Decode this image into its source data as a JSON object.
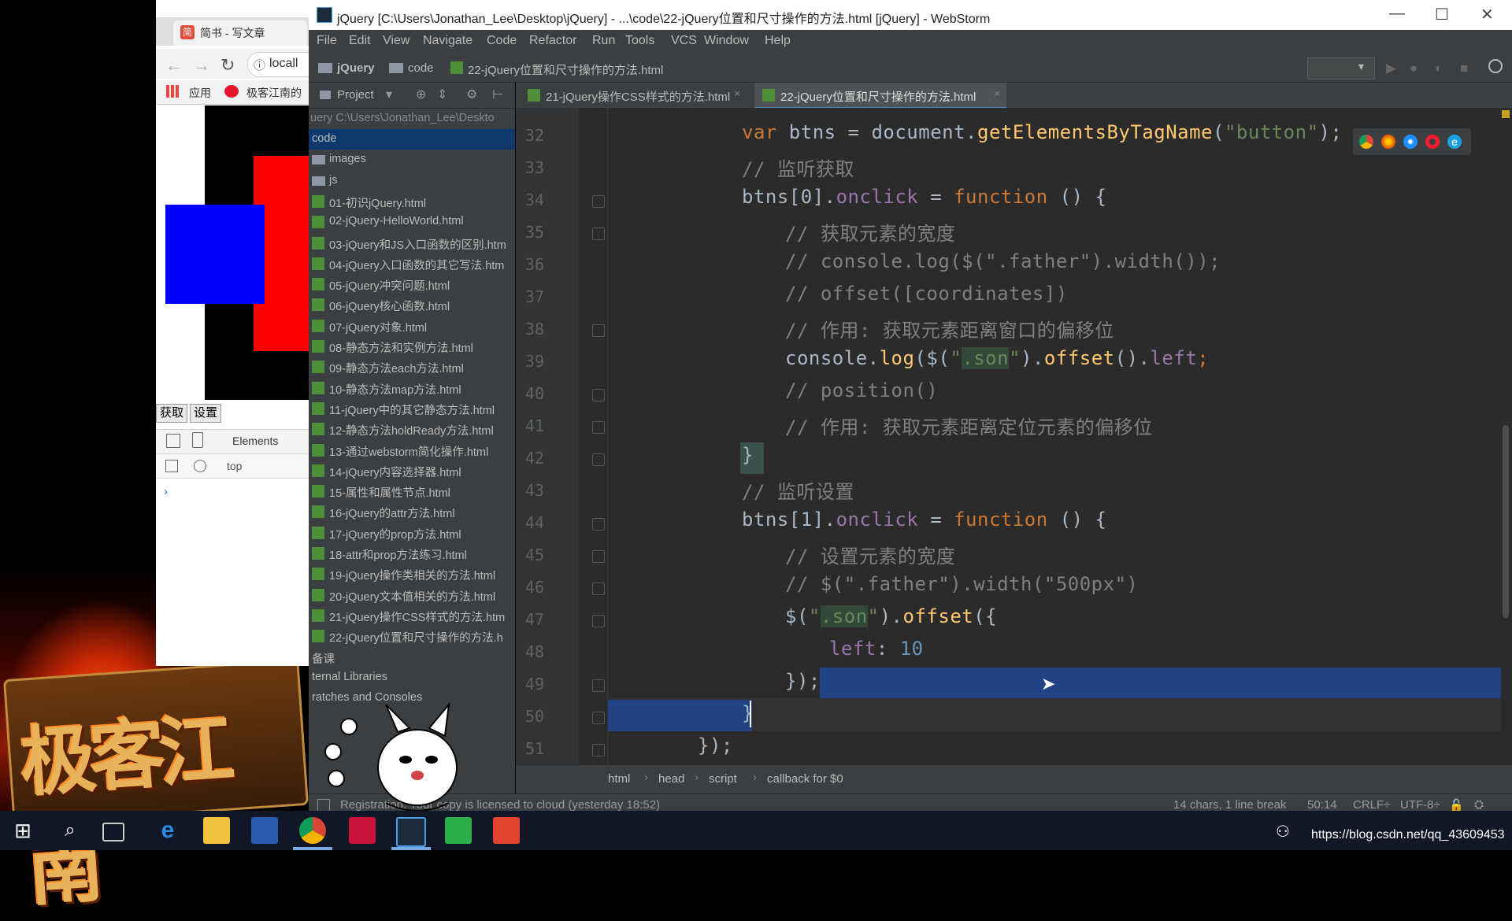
{
  "browser": {
    "tab_title": "简书 - 写文章",
    "address_text": "locall",
    "bookmarks": {
      "apps": "应用",
      "site": "极客江南的"
    },
    "buttons": {
      "get": "获取",
      "set": "设置"
    },
    "devtools": {
      "elements_tab": "Elements",
      "context": "top",
      "prompt": "›"
    }
  },
  "ide": {
    "title": "jQuery [C:\\Users\\Jonathan_Lee\\Desktop\\jQuery] - ...\\code\\22-jQuery位置和尺寸操作的方法.html [jQuery] - WebStorm",
    "window_controls": {
      "minimize": "—",
      "maximize": "☐",
      "close": "✕"
    },
    "menu": [
      "File",
      "Edit",
      "View",
      "Navigate",
      "Code",
      "Refactor",
      "Run",
      "Tools",
      "VCS",
      "Window",
      "Help"
    ],
    "nav_breadcrumb": [
      "jQuery",
      "code",
      "22-jQuery位置和尺寸操作的方法.html"
    ],
    "project_panel": {
      "title": "Project",
      "root_path": "uery  C:\\Users\\Jonathan_Lee\\Deskto",
      "items": [
        {
          "label": "code",
          "type": "text",
          "selected": true
        },
        {
          "label": "images",
          "type": "folder"
        },
        {
          "label": "js",
          "type": "folder"
        },
        {
          "label": "01-初识jQuery.html",
          "type": "file"
        },
        {
          "label": "02-jQuery-HelloWorld.html",
          "type": "file"
        },
        {
          "label": "03-jQuery和JS入口函数的区别.htm",
          "type": "file"
        },
        {
          "label": "04-jQuery入口函数的其它写法.htm",
          "type": "file"
        },
        {
          "label": "05-jQuery冲突问题.html",
          "type": "file"
        },
        {
          "label": "06-jQuery核心函数.html",
          "type": "file"
        },
        {
          "label": "07-jQuery对象.html",
          "type": "file"
        },
        {
          "label": "08-静态方法和实例方法.html",
          "type": "file"
        },
        {
          "label": "09-静态方法each方法.html",
          "type": "file"
        },
        {
          "label": "10-静态方法map方法.html",
          "type": "file"
        },
        {
          "label": "11-jQuery中的其它静态方法.html",
          "type": "file"
        },
        {
          "label": "12-静态方法holdReady方法.html",
          "type": "file"
        },
        {
          "label": "13-通过webstorm简化操作.html",
          "type": "file"
        },
        {
          "label": "14-jQuery内容选择器.html",
          "type": "file"
        },
        {
          "label": "15-属性和属性节点.html",
          "type": "file"
        },
        {
          "label": "16-jQuery的attr方法.html",
          "type": "file"
        },
        {
          "label": "17-jQuery的prop方法.html",
          "type": "file"
        },
        {
          "label": "18-attr和prop方法练习.html",
          "type": "file"
        },
        {
          "label": "19-jQuery操作类相关的方法.html",
          "type": "file"
        },
        {
          "label": "20-jQuery文本值相关的方法.html",
          "type": "file"
        },
        {
          "label": "21-jQuery操作CSS样式的方法.htm",
          "type": "file"
        },
        {
          "label": "22-jQuery位置和尺寸操作的方法.h",
          "type": "file"
        },
        {
          "label": "备课",
          "type": "text"
        },
        {
          "label": "ternal Libraries",
          "type": "text"
        },
        {
          "label": "ratches and Consoles",
          "type": "text"
        }
      ]
    },
    "tabs": [
      {
        "label": "21-jQuery操作CSS样式的方法.html",
        "close": "×"
      },
      {
        "label": "22-jQuery位置和尺寸操作的方法.html",
        "close": "×"
      }
    ],
    "line_numbers": [
      "32",
      "33",
      "34",
      "35",
      "36",
      "37",
      "38",
      "39",
      "40",
      "41",
      "42",
      "43",
      "44",
      "45",
      "46",
      "47",
      "48",
      "49",
      "50",
      "51"
    ],
    "code": {
      "l32_kw": "var",
      "l32_a": " btns = document.",
      "l32_fn": "getElementsByTagName",
      "l32_b": "(",
      "l32_str": "\"button\"",
      "l32_c": ");",
      "l33": "// 监听获取",
      "l34_a": "btns[0].",
      "l34_prop": "onclick",
      "l34_b": " = ",
      "l34_kw": "function",
      "l34_c": " () {",
      "l35": "// 获取元素的宽度",
      "l36": "// console.log($(\".father\").width());",
      "l37": "// offset([coordinates])",
      "l38": "// 作用: 获取元素距离窗口的偏移位",
      "l39_a": "console.",
      "l39_fn": "log",
      "l39_b": "($(",
      "l39_s1": "\"",
      "l39_hl": ".son",
      "l39_s2": "\"",
      "l39_c": ").",
      "l39_fn2": "offset",
      "l39_d": "().",
      "l39_prop": "left",
      "l39_e": ";",
      "l40": "// position()",
      "l41": "// 作用: 获取元素距离定位元素的偏移位",
      "l42": "}",
      "l43": "// 监听设置",
      "l44_a": "btns[1].",
      "l44_prop": "onclick",
      "l44_b": " = ",
      "l44_kw": "function",
      "l44_c": " () {",
      "l45": "// 设置元素的宽度",
      "l46": "// $(\".father\").width(\"500px\")",
      "l47_a": "$(",
      "l47_s1": "\"",
      "l47_hl": ".son",
      "l47_s2": "\"",
      "l47_b": ").",
      "l47_fn": "offset",
      "l47_c": "({",
      "l48_prop": "left",
      "l48_a": ": ",
      "l48_num": "10",
      "l49": "});",
      "l50": "}",
      "l51": "});"
    },
    "editor_breadcrumb": [
      "html",
      "head",
      "script",
      "callback for $0"
    ],
    "status": {
      "left": "Registration: Your copy is licensed to cloud (yesterday 18:52)",
      "selection": "14 chars, 1 line break",
      "position": "50:14",
      "line_sep": "CRLF÷",
      "encoding": "UTF-8÷"
    }
  },
  "logo_text": "极客江南",
  "taskbar": {
    "url": "https://blog.csdn.net/qq_43609453",
    "url_red": "/43609453"
  },
  "colors": {
    "editor_bg": "#2b2b2b",
    "panel_bg": "#3c3f41",
    "selection": "#214283",
    "keyword": "#cc7832",
    "comment": "#808080",
    "function": "#ffc66d",
    "string": "#6a8759"
  }
}
